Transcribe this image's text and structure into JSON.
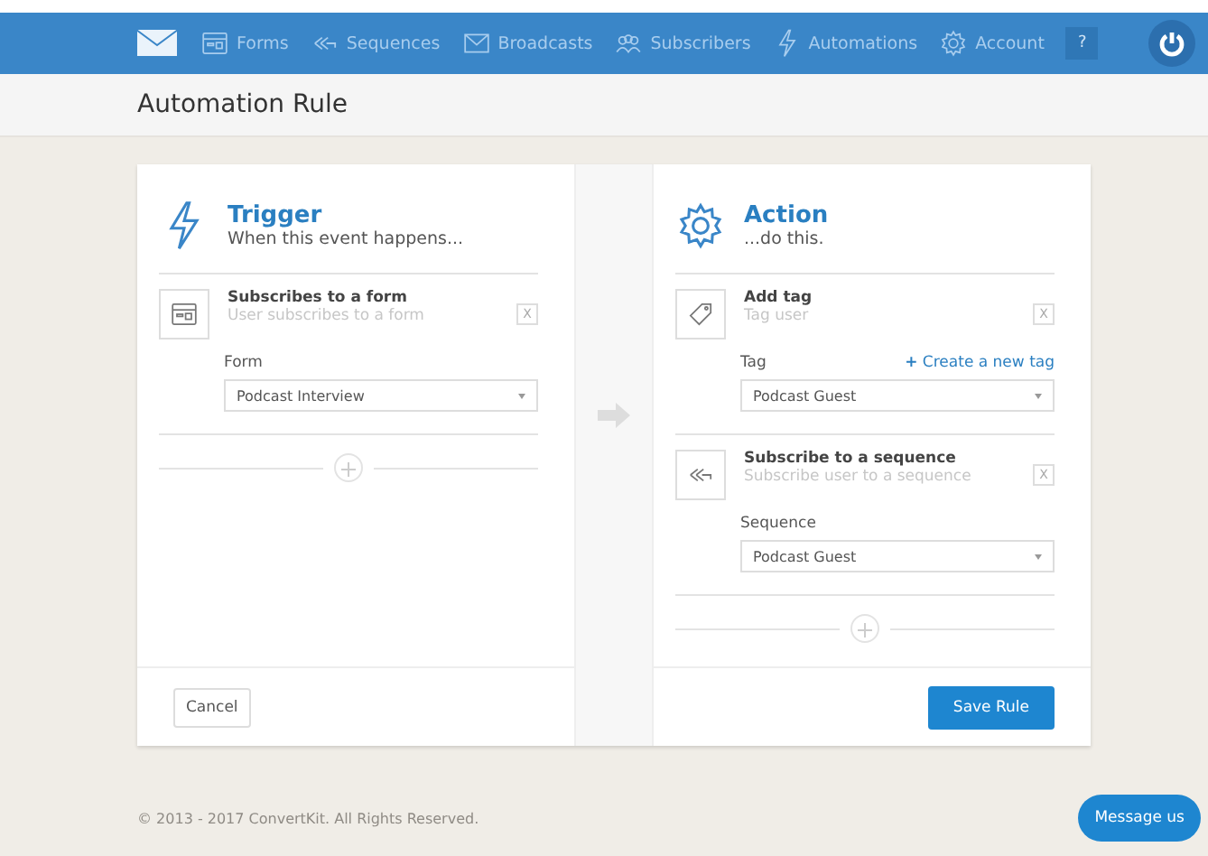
{
  "nav": {
    "items": [
      {
        "label": "Forms"
      },
      {
        "label": "Sequences"
      },
      {
        "label": "Broadcasts"
      },
      {
        "label": "Subscribers"
      },
      {
        "label": "Automations"
      },
      {
        "label": "Account"
      }
    ],
    "help": "?"
  },
  "page_title": "Automation Rule",
  "trigger": {
    "title": "Trigger",
    "subtitle": "When this event happens...",
    "steps": [
      {
        "kind": "form",
        "title": "Subscribes to a form",
        "description": "User subscribes to a form",
        "remove": "X",
        "field_label": "Form",
        "value": "Podcast Interview"
      }
    ]
  },
  "action": {
    "title": "Action",
    "subtitle": "...do this.",
    "steps": [
      {
        "kind": "tag",
        "title": "Add tag",
        "description": "Tag user",
        "remove": "X",
        "field_label": "Tag",
        "link": "**+** Create a new tag",
        "value": "Podcast Guest"
      },
      {
        "kind": "sequence",
        "title": "Subscribe to a sequence",
        "description": "Subscribe user to a sequence",
        "remove": "X",
        "field_label": "Sequence",
        "value": "Podcast Guest"
      }
    ]
  },
  "buttons": {
    "cancel": "Cancel",
    "save": "Save Rule"
  },
  "footer": "© 2013 - 2017 ConvertKit. All Rights Reserved.",
  "chat_button": "Message us"
}
